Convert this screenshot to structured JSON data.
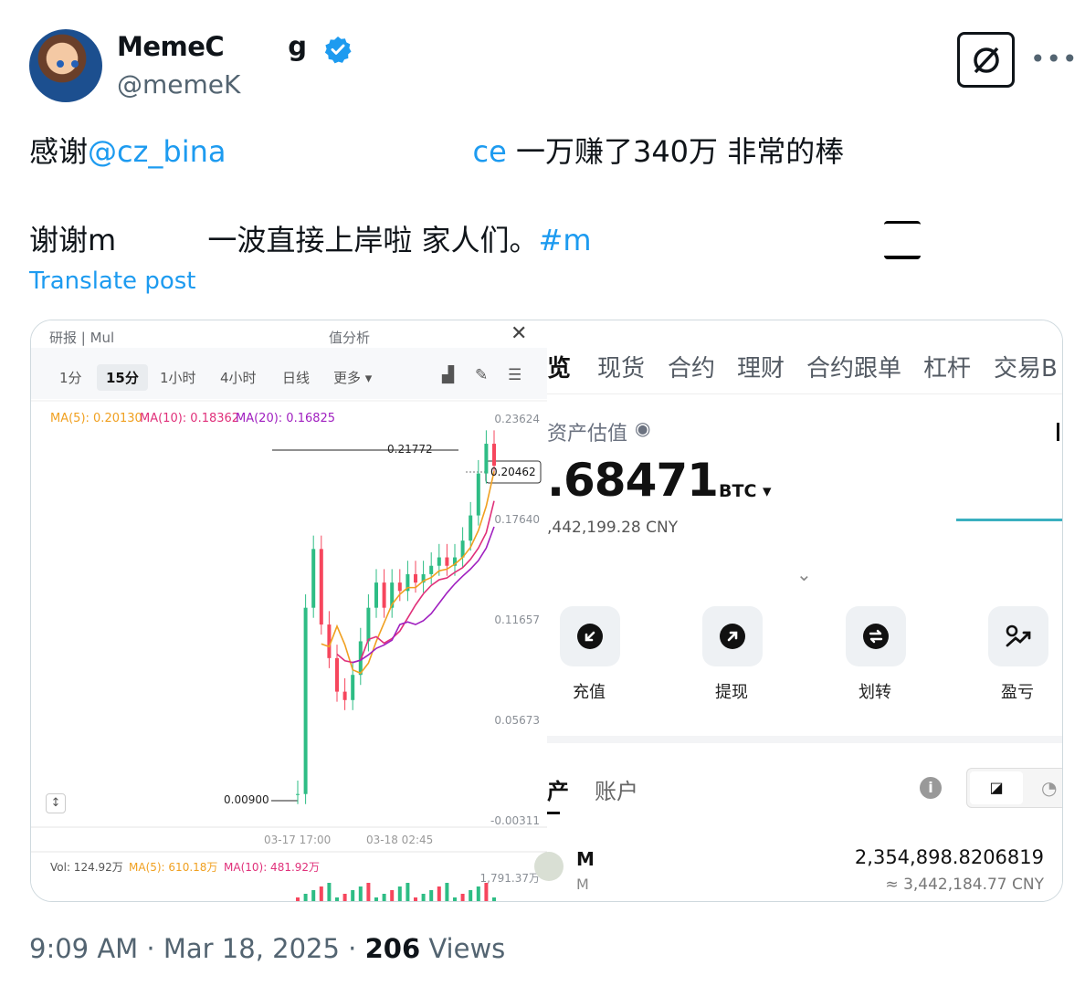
{
  "post": {
    "display_name": "MemeC",
    "display_name_tail": "g",
    "handle": "@memeK",
    "line1_prefix": "感谢",
    "line1_mention1": "@cz_bina",
    "line1_mention2": "ce",
    "line1_rest": " 一万赚了340万  非常的棒",
    "line2_text": "谢谢m",
    "line2_rest": " 一波直接上岸啦  家人们。",
    "line2_hashtag": "#m",
    "translate": "Translate post",
    "timestamp": "9:09 AM · Mar 18, 2025 · ",
    "views_count": "206",
    "views_label": " Views"
  },
  "icons": {
    "verified": "verified-badge-icon",
    "grok": "grok-icon",
    "more": "more-icon"
  },
  "chart_panel": {
    "header_left": "研报 | Mul",
    "header_right": "值分析",
    "timeframes": [
      "1分",
      "15分",
      "1小时",
      "4小时",
      "日线",
      "更多"
    ],
    "active_timeframe": "15分",
    "ma5": "MA(5): 0.20130",
    "ma10": "MA(10): 0.18362",
    "ma20": "MA(20): 0.16825",
    "y_labels": [
      "0.23624",
      "0.17640",
      "0.11657",
      "0.05673",
      "-0.00311"
    ],
    "high_label": "0.21772",
    "current_price": "0.20462",
    "low_label": "0.00900",
    "x_labels": [
      "03-17 17:00",
      "03-18 02:45"
    ],
    "vol": "Vol: 124.92万",
    "vol_ma5": "MA(5): 610.18万",
    "vol_ma10": "MA(10): 481.92万",
    "vol_axis": "1,791.37万"
  },
  "chart_data": {
    "type": "candlestick",
    "y_range": [
      -0.00311,
      0.23624
    ],
    "x_labels": [
      "03-17 17:00",
      "03-18 02:45"
    ],
    "high": 0.21772,
    "low": 0.009,
    "last": 0.20462,
    "ma_series": [
      {
        "name": "MA(5)",
        "value": 0.2013,
        "color": "#f0a020"
      },
      {
        "name": "MA(10)",
        "value": 0.18362,
        "color": "#e0307a"
      },
      {
        "name": "MA(20)",
        "value": 0.16825,
        "color": "#a020c0"
      }
    ]
  },
  "wallet_panel": {
    "tabs": [
      "览",
      "现货",
      "合约",
      "理财",
      "合约跟单",
      "杠杆",
      "交易B"
    ],
    "assets_label": "资产估值",
    "btc_value": ".68471",
    "btc_unit": "BTC",
    "cny_value": ",442,199.28 CNY",
    "actions": [
      "充值",
      "提现",
      "划转",
      "盈亏"
    ],
    "section_tabs": [
      "产",
      "账户"
    ],
    "asset_name": "M",
    "asset_sub": "M",
    "asset_amount": "2,354,898.8206819",
    "asset_cny": "≈ 3,442,184.77 CNY"
  }
}
